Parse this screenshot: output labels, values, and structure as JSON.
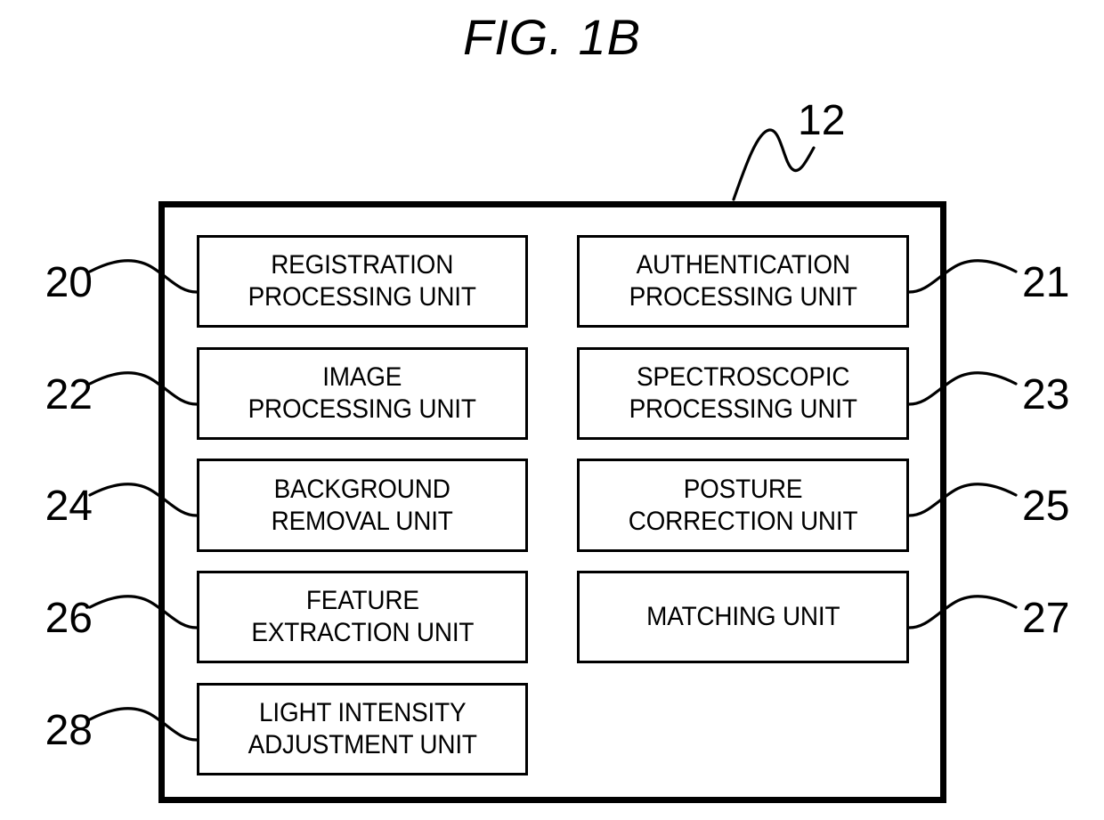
{
  "figure": {
    "title": "FIG. 1B",
    "apparatus_ref": "12",
    "stroke_color": "#000000",
    "background_color": "#ffffff"
  },
  "units": [
    {
      "ref": "20",
      "ref_side": "left",
      "column": "left",
      "row": 1,
      "label": "REGISTRATION\nPROCESSING UNIT"
    },
    {
      "ref": "21",
      "ref_side": "right",
      "column": "right",
      "row": 1,
      "label": "AUTHENTICATION\nPROCESSING UNIT"
    },
    {
      "ref": "22",
      "ref_side": "left",
      "column": "left",
      "row": 2,
      "label": "IMAGE\nPROCESSING UNIT"
    },
    {
      "ref": "23",
      "ref_side": "right",
      "column": "right",
      "row": 2,
      "label": "SPECTROSCOPIC\nPROCESSING UNIT"
    },
    {
      "ref": "24",
      "ref_side": "left",
      "column": "left",
      "row": 3,
      "label": "BACKGROUND\nREMOVAL UNIT"
    },
    {
      "ref": "25",
      "ref_side": "right",
      "column": "right",
      "row": 3,
      "label": "POSTURE\nCORRECTION UNIT"
    },
    {
      "ref": "26",
      "ref_side": "left",
      "column": "left",
      "row": 4,
      "label": "FEATURE\nEXTRACTION UNIT"
    },
    {
      "ref": "27",
      "ref_side": "right",
      "column": "right",
      "row": 4,
      "label": "MATCHING UNIT"
    },
    {
      "ref": "28",
      "ref_side": "left",
      "column": "left",
      "row": 5,
      "label": "LIGHT INTENSITY\nADJUSTMENT UNIT"
    }
  ]
}
